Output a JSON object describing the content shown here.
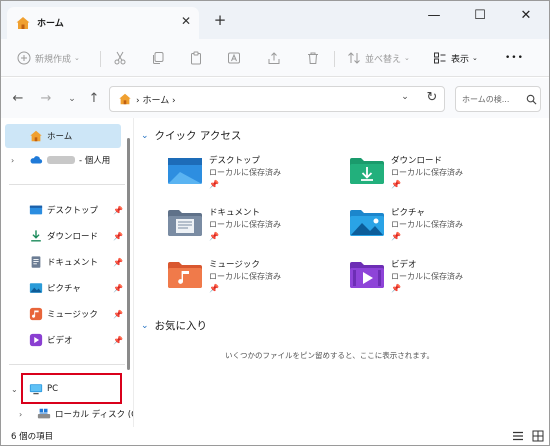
{
  "tab": {
    "title": "ホーム",
    "close": "✕",
    "new": "+"
  },
  "window_controls": {
    "minimize": "—",
    "maximize": "☐",
    "close": "✕"
  },
  "toolbar": {
    "new_label": "新規作成",
    "sort_label": "並べ替え",
    "view_label": "表示",
    "more": "•••"
  },
  "address": {
    "path": "ホーム ›",
    "search_placeholder": "ホームの検..."
  },
  "sidebar": {
    "home": "ホーム",
    "onedrive_suffix": "- 個人用",
    "quick": [
      {
        "label": "デスクトップ",
        "icon": "desktop-icon"
      },
      {
        "label": "ダウンロード",
        "icon": "download-icon"
      },
      {
        "label": "ドキュメント",
        "icon": "documents-icon"
      },
      {
        "label": "ピクチャ",
        "icon": "pictures-icon"
      },
      {
        "label": "ミュージック",
        "icon": "music-icon"
      },
      {
        "label": "ビデオ",
        "icon": "videos-icon"
      }
    ],
    "pc": "PC",
    "local_disk": "ローカル ディスク (C"
  },
  "content": {
    "quick_access_title": "クイック アクセス",
    "favorites_title": "お気に入り",
    "favorites_empty": "いくつかのファイルをピン留めすると、ここに表示されます。",
    "folders": [
      {
        "name": "デスクトップ",
        "sub": "ローカルに保存済み",
        "icon": "desktop-folder-icon"
      },
      {
        "name": "ダウンロード",
        "sub": "ローカルに保存済み",
        "icon": "downloads-folder-icon"
      },
      {
        "name": "ドキュメント",
        "sub": "ローカルに保存済み",
        "icon": "documents-folder-icon"
      },
      {
        "name": "ピクチャ",
        "sub": "ローカルに保存済み",
        "icon": "pictures-folder-icon"
      },
      {
        "name": "ミュージック",
        "sub": "ローカルに保存済み",
        "icon": "music-folder-icon"
      },
      {
        "name": "ビデオ",
        "sub": "ローカルに保存済み",
        "icon": "videos-folder-icon"
      }
    ]
  },
  "status": {
    "count": "6 個の項目"
  },
  "colors": {
    "accent": "#1f6fc2",
    "highlight_box": "#d9001b",
    "selected_bg": "#cde6f7"
  }
}
